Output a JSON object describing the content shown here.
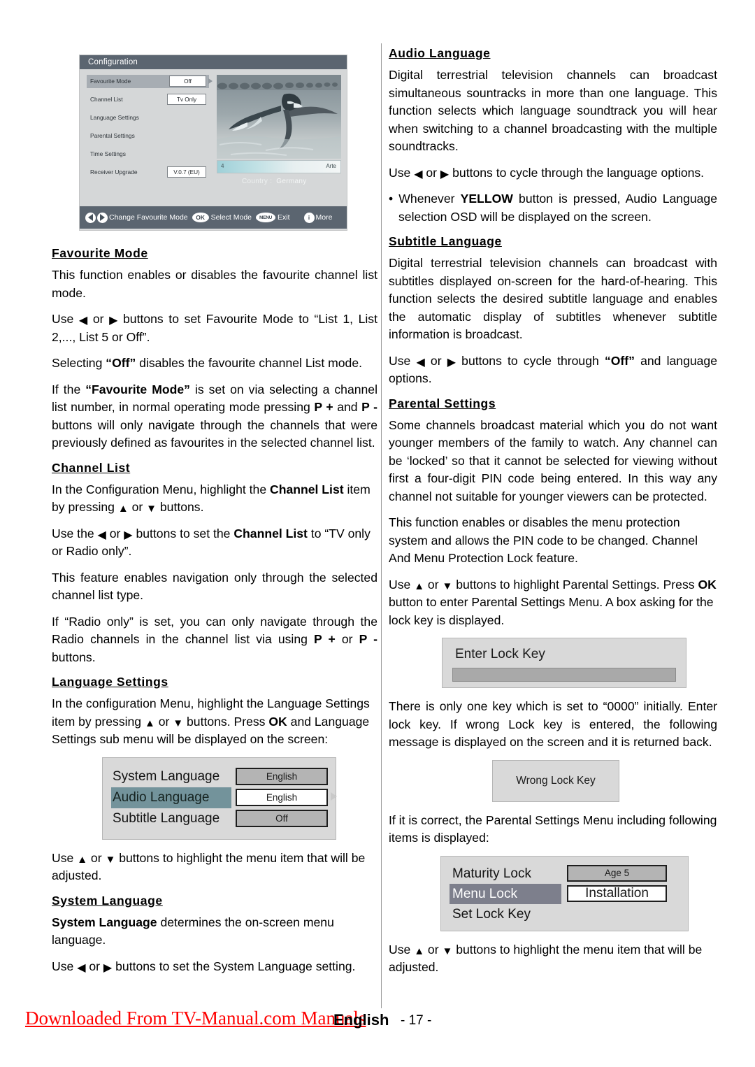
{
  "tv_screenshot": {
    "title": "Configuration",
    "menu_items": [
      {
        "label": "Favourite Mode",
        "value": "Off",
        "selected": true,
        "caret": true
      },
      {
        "label": "Channel List",
        "value": "Tv Only",
        "selected": false,
        "caret": false
      },
      {
        "label": "Language Settings",
        "value": "",
        "selected": false,
        "caret": false
      },
      {
        "label": "Parental Settings",
        "value": "",
        "selected": false,
        "caret": false
      },
      {
        "label": "Time Settings",
        "value": "",
        "selected": false,
        "caret": false
      },
      {
        "label": "Receiver Upgrade",
        "value": "V.0.7 (EU)",
        "selected": false,
        "caret": false
      }
    ],
    "channel_bar": {
      "number": "4",
      "name": "Arte"
    },
    "country_label": "Country :",
    "country_value": "Germany",
    "footer_hints": [
      {
        "icon": "left-right-arrow-icons",
        "label": "Change Favourite Mode"
      },
      {
        "icon": "ok-button-icon",
        "label": "Select Mode"
      },
      {
        "icon": "menu-button-icon",
        "label": "Exit"
      },
      {
        "icon": "info-button-icon",
        "label": "More"
      }
    ],
    "ok_badge": "OK",
    "menu_badge": "MENU",
    "info_badge": "i"
  },
  "left_column": {
    "s1": {
      "heading": "Favourite Mode",
      "p1": "This function enables or disables the favourite channel list mode.",
      "p2_a": "Use ",
      "p2_b": " or ",
      "p2_c": " buttons to set Favourite Mode to “List 1, List 2,..., List 5 or Off”.",
      "p3_a": "Selecting ",
      "p3_b": "“Off”",
      "p3_c": " disables the favourite channel List mode.",
      "p4_a": "If the ",
      "p4_b": "“Favourite Mode”",
      "p4_c": " is set on via selecting a channel list number, in normal operating mode pressing ",
      "p4_d": "P +",
      "p4_e": " and ",
      "p4_f": "P -",
      "p4_g": " buttons will only navigate  through the channels that were previously defined as favourites in the selected channel list."
    },
    "s2": {
      "heading": "Channel List",
      "p1_a": "In the Configuration Menu, highlight the ",
      "p1_b": "Channel List",
      "p1_c": " item by pressing ",
      "p1_d": " or ",
      "p1_e": " buttons.",
      "p2_a": "Use the ",
      "p2_b": " or ",
      "p2_c": " buttons to set the ",
      "p2_d": "Channel List",
      "p2_e": " to “TV only or Radio only”.",
      "p3": "This feature enables navigation only through the selected channel list type.",
      "p4_a": "If “Radio only” is set, you can only navigate through the Radio channels in the channel list via using  ",
      "p4_b": "P +",
      "p4_c": " or ",
      "p4_d": "P -",
      "p4_e": " buttons."
    },
    "s3": {
      "heading": "Language Settings",
      "p1_a": "In the configuration Menu, highlight the Language Settings item by pressing ",
      "p1_b": " or ",
      "p1_c": " buttons. Press ",
      "p1_d": "OK",
      "p1_e": " and Language Settings sub menu will be displayed on the screen:",
      "osd_rows": [
        {
          "name": "System Language",
          "value": "English",
          "selected": false
        },
        {
          "name": "Audio Language",
          "value": "English",
          "selected": true
        },
        {
          "name": "Subtitle Language",
          "value": "Off",
          "selected": false
        }
      ],
      "p2_a": "Use ",
      "p2_b": " or ",
      "p2_c": " buttons to highlight the menu item that will be adjusted."
    },
    "s4": {
      "heading": "System Language",
      "p1_a": "System Language",
      "p1_b": " determines the on-screen menu language.",
      "p2_a": "Use ",
      "p2_b": " or ",
      "p2_c": " buttons to set the System Language setting."
    }
  },
  "right_column": {
    "s1": {
      "heading": "Audio Language",
      "p1": "Digital terrestrial television channels can broadcast simultaneous sountracks in more than one language. This function selects which language soundtrack you will hear when switching to a channel broadcasting with the multiple soundtracks.",
      "p2_a": "Use ",
      "p2_b": " or ",
      "p2_c": " buttons to cycle through the language options.",
      "b1_a": "• Whenever ",
      "b1_b": "YELLOW",
      "b1_c": " button is pressed, Audio Language selection OSD will be displayed on the screen."
    },
    "s2": {
      "heading": "Subtitle Language",
      "p1": "Digital terrestrial television channels can broadcast with subtitles displayed on-screen for the hard-of-hearing. This function selects the desired subtitle language and enables the automatic display of subtitles whenever subtitle information is broadcast.",
      "p2_a": "Use ",
      "p2_b": " or ",
      "p2_c": " buttons to cycle through ",
      "p2_d": "“Off”",
      "p2_e": " and language options."
    },
    "s3": {
      "heading": "Parental Settings",
      "p1": "Some channels broadcast material which you do not want younger members of the family to watch. Any channel can be ‘locked’ so that it cannot be selected for viewing without first a four-digit PIN code being entered. In this way any channel not suitable for younger viewers can be protected.",
      "p2": "This function enables or disables the menu protection system and allows the PIN code to be changed. Channel And Menu Protection Lock feature.",
      "p3_a": "Use ",
      "p3_b": " or ",
      "p3_c": " buttons to highlight Parental Settings. Press ",
      "p3_d": "OK",
      "p3_e": " button to enter Parental Settings Menu.  A box asking for the lock key is displayed.",
      "lock_box_title": "Enter Lock Key",
      "lock_box_value": "",
      "p4": "There is only one key which is set to “0000” initially. Enter lock key. If wrong Lock key is entered, the following message is displayed on the screen and it is returned back.",
      "wrong_box_title": "Wrong Lock Key",
      "p5": "If it is correct, the Parental Settings Menu including following items is displayed:",
      "osd_rows": [
        {
          "name": "Maturity Lock",
          "value": "Age 5",
          "selected": false
        },
        {
          "name": "Menu Lock",
          "value": "Installation",
          "selected": true
        },
        {
          "name": "Set Lock Key",
          "value": "",
          "selected": false
        }
      ],
      "p6_a": "Use ",
      "p6_b": " or ",
      "p6_c": " buttons to highlight the menu item that will be adjusted."
    }
  },
  "footer": {
    "watermark": "Downloaded From TV-Manual.com Manuals",
    "language": "English",
    "page": "- 17 -"
  },
  "colors": {
    "watermark": "#ff0000",
    "tv_title_bar": "#5b6570",
    "tv_body": "#d5d7d8",
    "osd_panel": "#d9d9d9",
    "osd_selected_lang": "#73939b",
    "osd_selected_parental": "#7d7f8c",
    "divider": "#9a9a9a"
  }
}
